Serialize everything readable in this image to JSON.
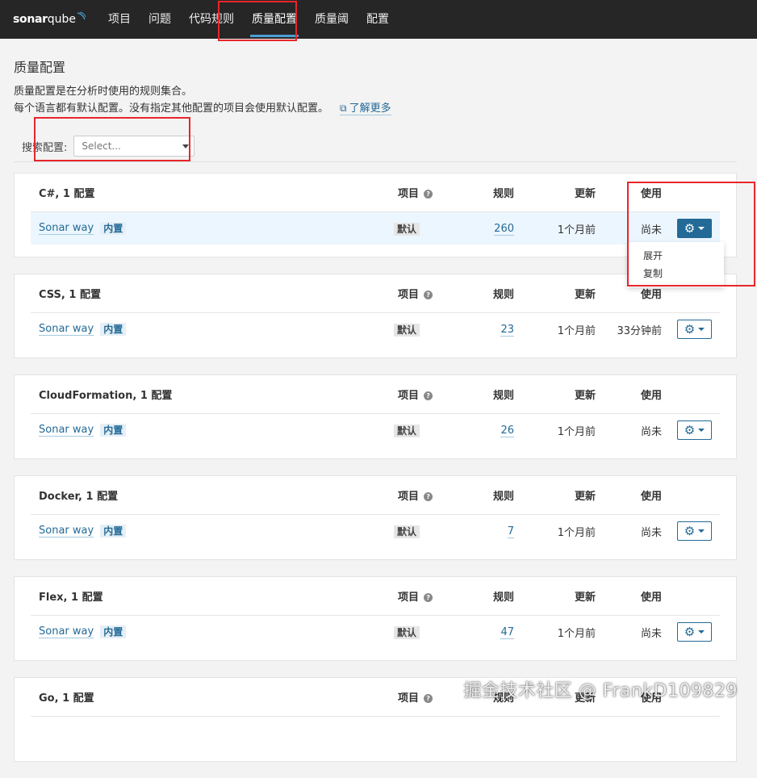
{
  "nav": {
    "logo_sonar": "sonar",
    "logo_qube": "qube",
    "items": [
      {
        "label": "项目"
      },
      {
        "label": "问题"
      },
      {
        "label": "代码规则"
      },
      {
        "label": "质量配置"
      },
      {
        "label": "质量阈"
      },
      {
        "label": "配置"
      }
    ],
    "active_index": 3
  },
  "page": {
    "title": "质量配置",
    "desc_line1": "质量配置是在分析时使用的规则集合。",
    "desc_line2": "每个语言都有默认配置。没有指定其他配置的项目会使用默认配置。",
    "learn_more": "了解更多",
    "search_label": "搜索配置:",
    "search_placeholder": "Select..."
  },
  "columns": {
    "projects": "项目",
    "rules": "规则",
    "updated": "更新",
    "used": "使用"
  },
  "cards": [
    {
      "header": "C#, 1 配置",
      "profile": "Sonar way",
      "builtin": "内置",
      "default": "默认",
      "rules": "260",
      "updated": "1个月前",
      "used": "尚未"
    },
    {
      "header": "CSS, 1 配置",
      "profile": "Sonar way",
      "builtin": "内置",
      "default": "默认",
      "rules": "23",
      "updated": "1个月前",
      "used": "33分钟前"
    },
    {
      "header": "CloudFormation, 1 配置",
      "profile": "Sonar way",
      "builtin": "内置",
      "default": "默认",
      "rules": "26",
      "updated": "1个月前",
      "used": "尚未"
    },
    {
      "header": "Docker, 1 配置",
      "profile": "Sonar way",
      "builtin": "内置",
      "default": "默认",
      "rules": "7",
      "updated": "1个月前",
      "used": "尚未"
    },
    {
      "header": "Flex, 1 配置",
      "profile": "Sonar way",
      "builtin": "内置",
      "default": "默认",
      "rules": "47",
      "updated": "1个月前",
      "used": "尚未"
    },
    {
      "header": "Go, 1 配置"
    }
  ],
  "dropdown": {
    "items": [
      "展开",
      "复制"
    ]
  },
  "watermark": "掘金技术社区 @ FrankD109829",
  "colors": {
    "topbar": "#262626",
    "accent": "#236a97",
    "highlight_row": "#ecf6fe",
    "annotation": "#e8262b"
  }
}
